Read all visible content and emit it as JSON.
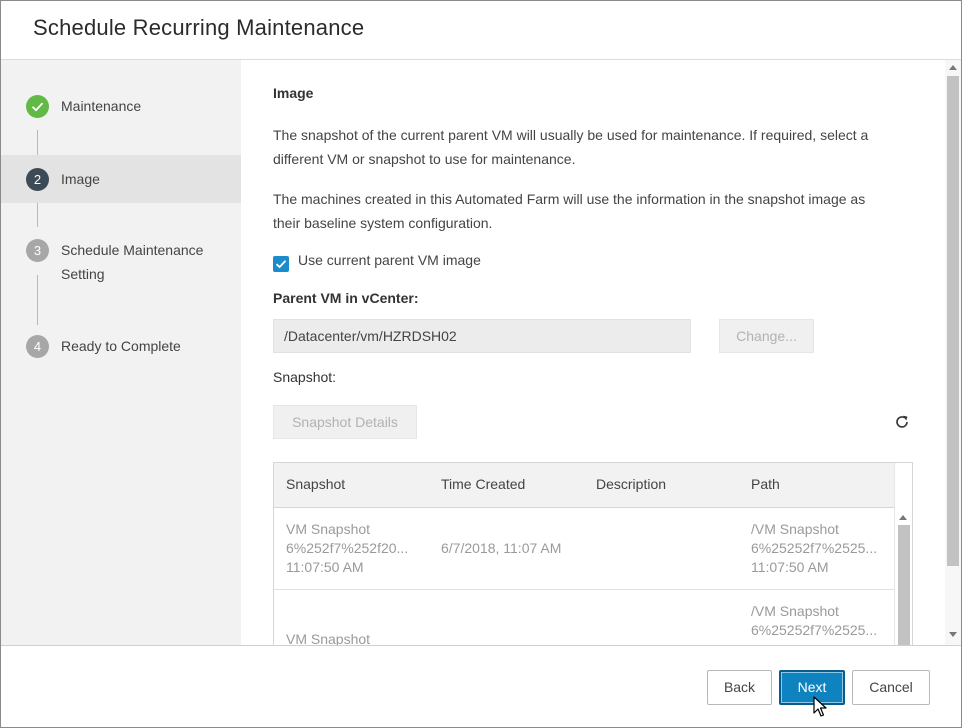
{
  "dialog": {
    "title": "Schedule Recurring Maintenance"
  },
  "steps": [
    {
      "num": "✓",
      "label": "Maintenance",
      "state": "done",
      "color": "#62b946"
    },
    {
      "num": "2",
      "label": "Image",
      "state": "active",
      "color": "#3d4b57"
    },
    {
      "num": "3",
      "label_line1": "Schedule Maintenance",
      "label_line2": "Setting",
      "state": "pending",
      "color": "#a7a7a7"
    },
    {
      "num": "4",
      "label": "Ready to Complete",
      "state": "pending",
      "color": "#a7a7a7"
    }
  ],
  "content": {
    "heading": "Image",
    "para1_line1": "The snapshot of the current parent VM will usually be used for maintenance. If required, select a",
    "para1_line2": "different VM or snapshot to use for maintenance.",
    "para2_line1": "The machines created in this Automated Farm will use the information in the snapshot image as",
    "para2_line2": "their baseline system configuration.",
    "checkbox_label": "Use current parent VM image",
    "checkbox_checked": true,
    "parent_vm_label": "Parent VM in vCenter:",
    "parent_vm_value": "/Datacenter/vm/HZRDSH02",
    "change_button": "Change...",
    "snapshot_label": "Snapshot:",
    "snapshot_details_button": "Snapshot Details",
    "refresh_icon": "refresh-icon"
  },
  "table": {
    "columns": [
      "Snapshot",
      "Time Created",
      "Description",
      "Path"
    ],
    "rows": [
      {
        "snapshot": [
          "VM Snapshot",
          "6%252f7%252f20...",
          "11:07:50 AM"
        ],
        "time": "6/7/2018, 11:07 AM",
        "description": "",
        "path": [
          "/VM Snapshot",
          "6%25252f7%2525...",
          "11:07:50 AM"
        ]
      },
      {
        "snapshot": [
          "VM Snapshot"
        ],
        "time": "",
        "description": "",
        "path": [
          "/VM Snapshot",
          "6%25252f7%2525..."
        ]
      }
    ]
  },
  "footer": {
    "back": "Back",
    "next": "Next",
    "cancel": "Cancel"
  },
  "colors": {
    "accent": "#0f82c0",
    "success": "#62b946"
  }
}
